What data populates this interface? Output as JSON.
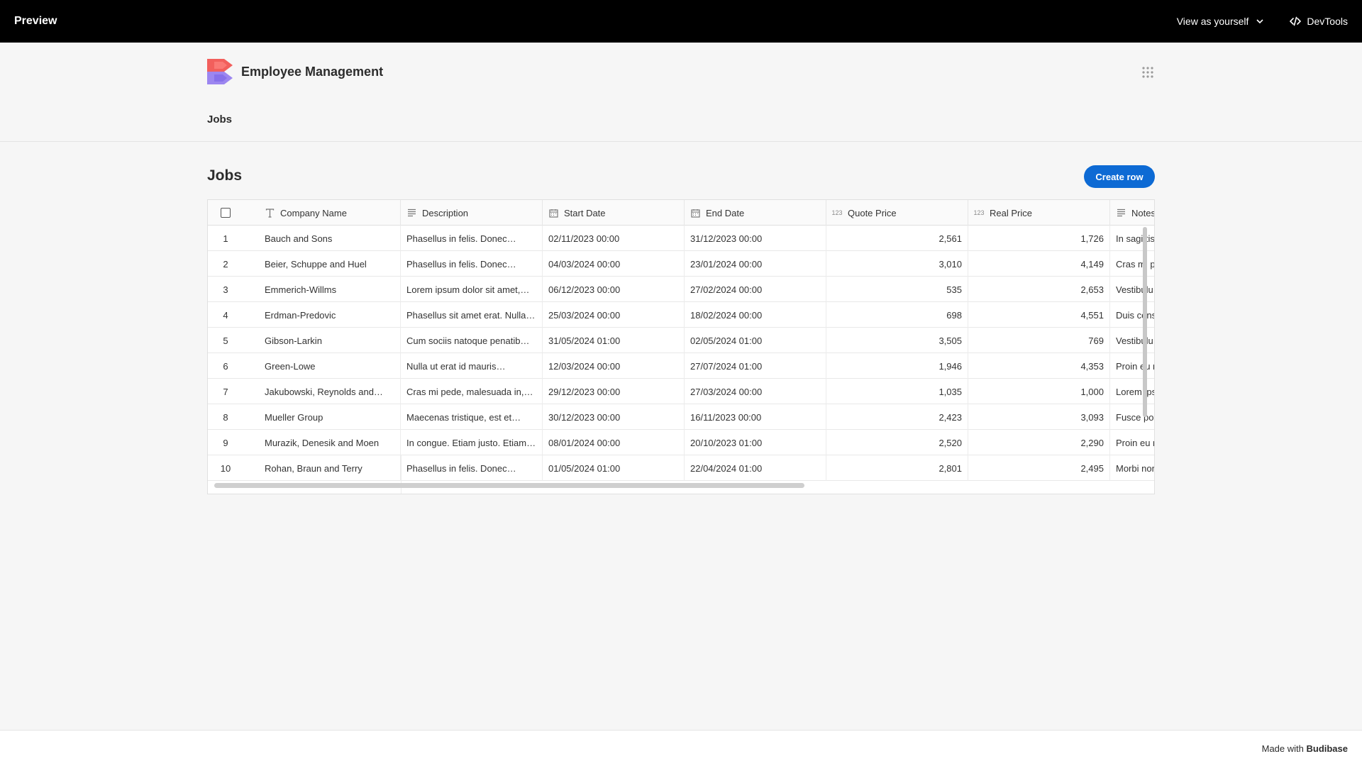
{
  "preview_bar": {
    "title": "Preview",
    "view_as_label": "View as yourself",
    "devtools_label": "DevTools"
  },
  "app": {
    "title": "Employee Management",
    "nav": [
      {
        "label": "Jobs"
      }
    ]
  },
  "page": {
    "title": "Jobs",
    "create_button": "Create row"
  },
  "table": {
    "columns": [
      {
        "label": "Company Name",
        "icon": "text-icon"
      },
      {
        "label": "Description",
        "icon": "longform-icon"
      },
      {
        "label": "Start Date",
        "icon": "calendar-icon"
      },
      {
        "label": "End Date",
        "icon": "calendar-icon"
      },
      {
        "label": "Quote Price",
        "icon": "number-icon"
      },
      {
        "label": "Real Price",
        "icon": "number-icon"
      },
      {
        "label": "Notes",
        "icon": "longform-icon"
      }
    ],
    "number_icon_text": "123",
    "rows": [
      {
        "index": "1",
        "company": "Bauch and Sons",
        "description": "Phasellus in felis. Donec…",
        "start": "02/11/2023 00:00",
        "end": "31/12/2023 00:00",
        "quote": "2,561",
        "real": "1,726",
        "notes": "In sagittis"
      },
      {
        "index": "2",
        "company": "Beier, Schuppe and Huel",
        "description": "Phasellus in felis. Donec…",
        "start": "04/03/2024 00:00",
        "end": "23/01/2024 00:00",
        "quote": "3,010",
        "real": "4,149",
        "notes": "Cras mi p"
      },
      {
        "index": "3",
        "company": "Emmerich-Willms",
        "description": "Lorem ipsum dolor sit amet,…",
        "start": "06/12/2023 00:00",
        "end": "27/02/2024 00:00",
        "quote": "535",
        "real": "2,653",
        "notes": "Vestibulu"
      },
      {
        "index": "4",
        "company": "Erdman-Predovic",
        "description": "Phasellus sit amet erat. Nulla…",
        "start": "25/03/2024 00:00",
        "end": "18/02/2024 00:00",
        "quote": "698",
        "real": "4,551",
        "notes": "Duis cons"
      },
      {
        "index": "5",
        "company": "Gibson-Larkin",
        "description": "Cum sociis natoque penatib…",
        "start": "31/05/2024 01:00",
        "end": "02/05/2024 01:00",
        "quote": "3,505",
        "real": "769",
        "notes": "Vestibulu"
      },
      {
        "index": "6",
        "company": "Green-Lowe",
        "description": "Nulla ut erat id mauris…",
        "start": "12/03/2024 00:00",
        "end": "27/07/2024 01:00",
        "quote": "1,946",
        "real": "4,353",
        "notes": "Proin eu r"
      },
      {
        "index": "7",
        "company": "Jakubowski, Reynolds and…",
        "description": "Cras mi pede, malesuada in,…",
        "start": "29/12/2023 00:00",
        "end": "27/03/2024 00:00",
        "quote": "1,035",
        "real": "1,000",
        "notes": "Lorem ips"
      },
      {
        "index": "8",
        "company": "Mueller Group",
        "description": "Maecenas tristique, est et…",
        "start": "30/12/2023 00:00",
        "end": "16/11/2023 00:00",
        "quote": "2,423",
        "real": "3,093",
        "notes": "Fusce pos"
      },
      {
        "index": "9",
        "company": "Murazik, Denesik and Moen",
        "description": "In congue. Etiam justo. Etiam…",
        "start": "08/01/2024 00:00",
        "end": "20/10/2023 01:00",
        "quote": "2,520",
        "real": "2,290",
        "notes": "Proin eu r"
      },
      {
        "index": "10",
        "company": "Rohan, Braun and Terry",
        "description": "Phasellus in felis. Donec…",
        "start": "01/05/2024 01:00",
        "end": "22/04/2024 01:00",
        "quote": "2,801",
        "real": "2,495",
        "notes": "Morbi nor"
      }
    ]
  },
  "footer": {
    "prefix": "Made with ",
    "brand": "Budibase"
  },
  "colors": {
    "accent": "#0d6ad4",
    "logo_top": "#f25f5c",
    "logo_bottom": "#9c86f0"
  }
}
